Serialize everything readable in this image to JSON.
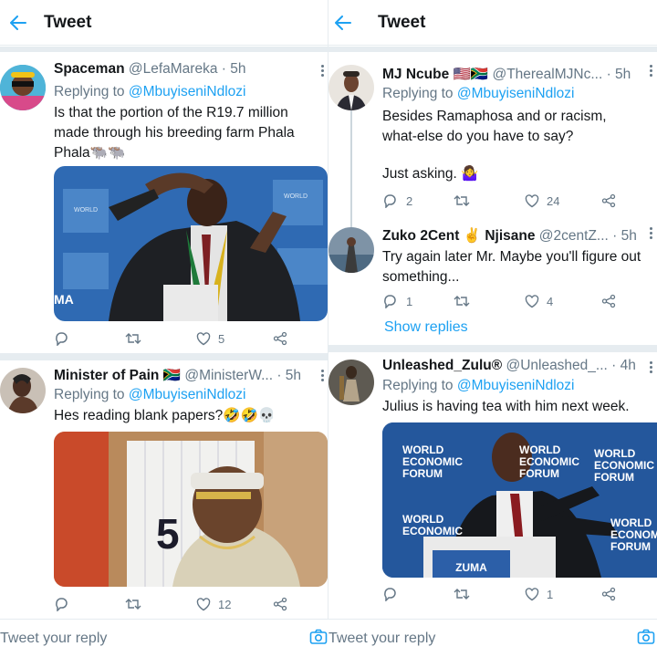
{
  "header": {
    "title": "Tweet"
  },
  "left": {
    "tweet1": {
      "name": "Spaceman",
      "handle": "@LefaMareka",
      "time": "· 5h",
      "replying_prefix": "Replying to",
      "replying_to": "@MbuyiseniNdlozi",
      "text": "Is that the portion of the R19.7 million made through his breeding farm Phala Phala🐃🐃",
      "media_caption": "MA",
      "likes": "5"
    },
    "tweet2": {
      "name": "Minister of Pain",
      "flag": "🇿🇦",
      "handle": "@MinisterW...",
      "time": "· 5h",
      "replying_prefix": "Replying to",
      "replying_to": "@MbuyiseniNdlozi",
      "text": "Hes reading blank papers?🤣🤣💀",
      "likes": "12"
    },
    "reply_placeholder": "Tweet your reply"
  },
  "right": {
    "tweet1": {
      "name": "MJ Ncube",
      "flags": "🇺🇸🇿🇦",
      "handle": "@TherealMJNc...",
      "time": "· 5h",
      "replying_prefix": "Replying to",
      "replying_to": "@MbuyiseniNdlozi",
      "text1": "Besides Ramaphosa and or racism, what-else do you have to say?",
      "text2": "Just asking. 🤷‍♀️",
      "replies": "2",
      "likes": "24"
    },
    "tweet2": {
      "name": "Zuko 2Cent",
      "emoji": "✌️",
      "name2": "Njisane",
      "handle": "@2centZ...",
      "time": "· 5h",
      "text": "Try again later Mr. Maybe you'll figure out something...",
      "replies": "1",
      "likes": "4"
    },
    "show_replies": "Show replies",
    "tweet3": {
      "name": "Unleashed_Zulu®",
      "handle": "@Unleashed_...",
      "time": "· 4h",
      "replying_prefix": "Replying to",
      "replying_to": "@MbuyiseniNdlozi",
      "text": "Julius is having tea with him next week.",
      "media_banner": "WORLD ECONOMIC FORUM",
      "media_banner_l1": "WORLD",
      "media_banner_l2": "ECONOMIC",
      "media_banner_l3": "FORUM",
      "media_nameplate": "ZUMA",
      "likes": "1"
    },
    "reply_placeholder": "Tweet your reply"
  },
  "colors": {
    "accent": "#1da1f2",
    "muted": "#657786",
    "border": "#e6ecf0"
  }
}
